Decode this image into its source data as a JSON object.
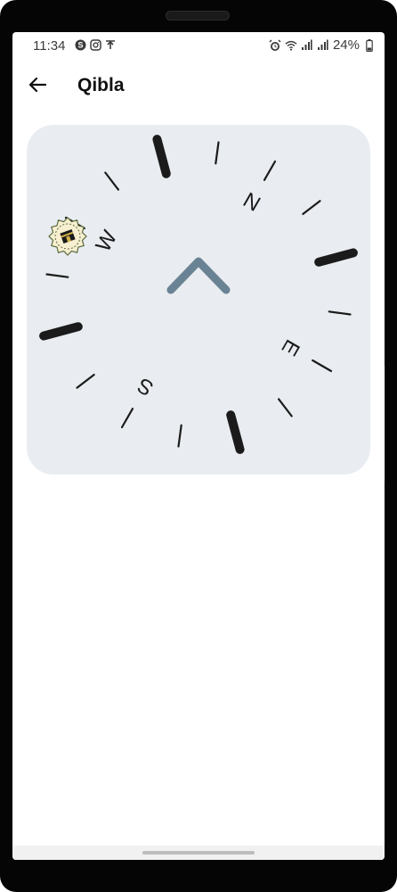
{
  "status_bar": {
    "time": "11:34",
    "battery": "24%",
    "left_icons": [
      "skype-icon",
      "instagram-icon",
      "download-arrow-icon"
    ],
    "right_icons": [
      "alarm-icon",
      "wifi-icon",
      "signal-icon",
      "signal-icon",
      "battery-icon"
    ]
  },
  "app_bar": {
    "title": "Qibla",
    "back_icon": "arrow-left-icon"
  },
  "compass": {
    "north_label": "N",
    "east_label": "E",
    "south_label": "S",
    "west_label": "W",
    "heading_icon": "chevron-up-icon",
    "qibla_marker_icon": "kaaba-icon",
    "colors": {
      "card_background": "#e9ecf0",
      "ticks": "#1b1b1b",
      "heading_arrow": "#6a8394",
      "marker_fill": "#f7efcf",
      "marker_ring": "#5a6b3e"
    }
  }
}
